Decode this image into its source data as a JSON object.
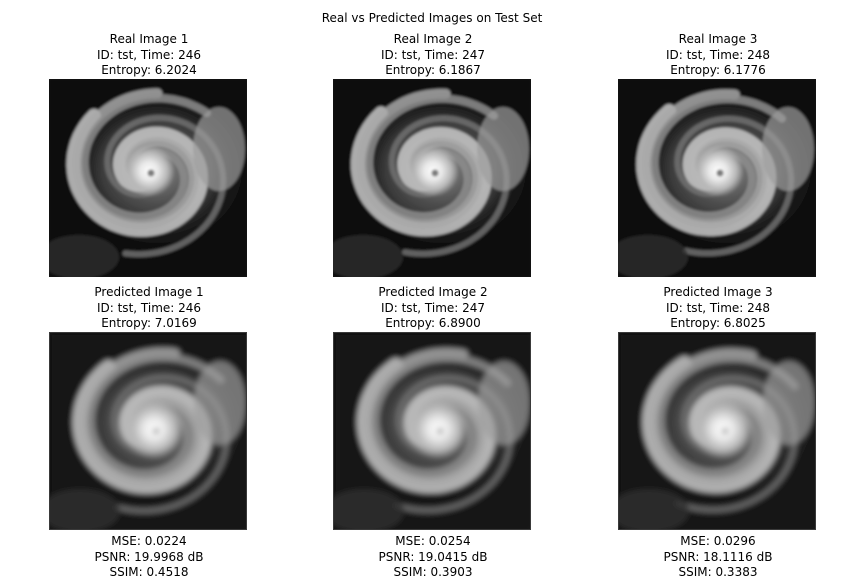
{
  "figure": {
    "title": "Real vs Predicted Images on Test Set"
  },
  "real": [
    {
      "title": "Real Image 1",
      "meta": "ID: tst, Time: 246",
      "entropy": "Entropy: 6.2024"
    },
    {
      "title": "Real Image 2",
      "meta": "ID: tst, Time: 247",
      "entropy": "Entropy: 6.1867"
    },
    {
      "title": "Real Image 3",
      "meta": "ID: tst, Time: 248",
      "entropy": "Entropy: 6.1776"
    }
  ],
  "predicted": [
    {
      "title": "Predicted Image 1",
      "meta": "ID: tst, Time: 246",
      "entropy": "Entropy: 7.0169",
      "mse": "MSE: 0.0224",
      "psnr": "PSNR: 19.9968 dB",
      "ssim": "SSIM: 0.4518"
    },
    {
      "title": "Predicted Image 2",
      "meta": "ID: tst, Time: 247",
      "entropy": "Entropy: 6.8900",
      "mse": "MSE: 0.0254",
      "psnr": "PSNR: 19.0415 dB",
      "ssim": "SSIM: 0.3903"
    },
    {
      "title": "Predicted Image 3",
      "meta": "ID: tst, Time: 248",
      "entropy": "Entropy: 6.8025",
      "mse": "MSE: 0.0296",
      "psnr": "PSNR: 18.1116 dB",
      "ssim": "SSIM: 0.3383"
    }
  ]
}
